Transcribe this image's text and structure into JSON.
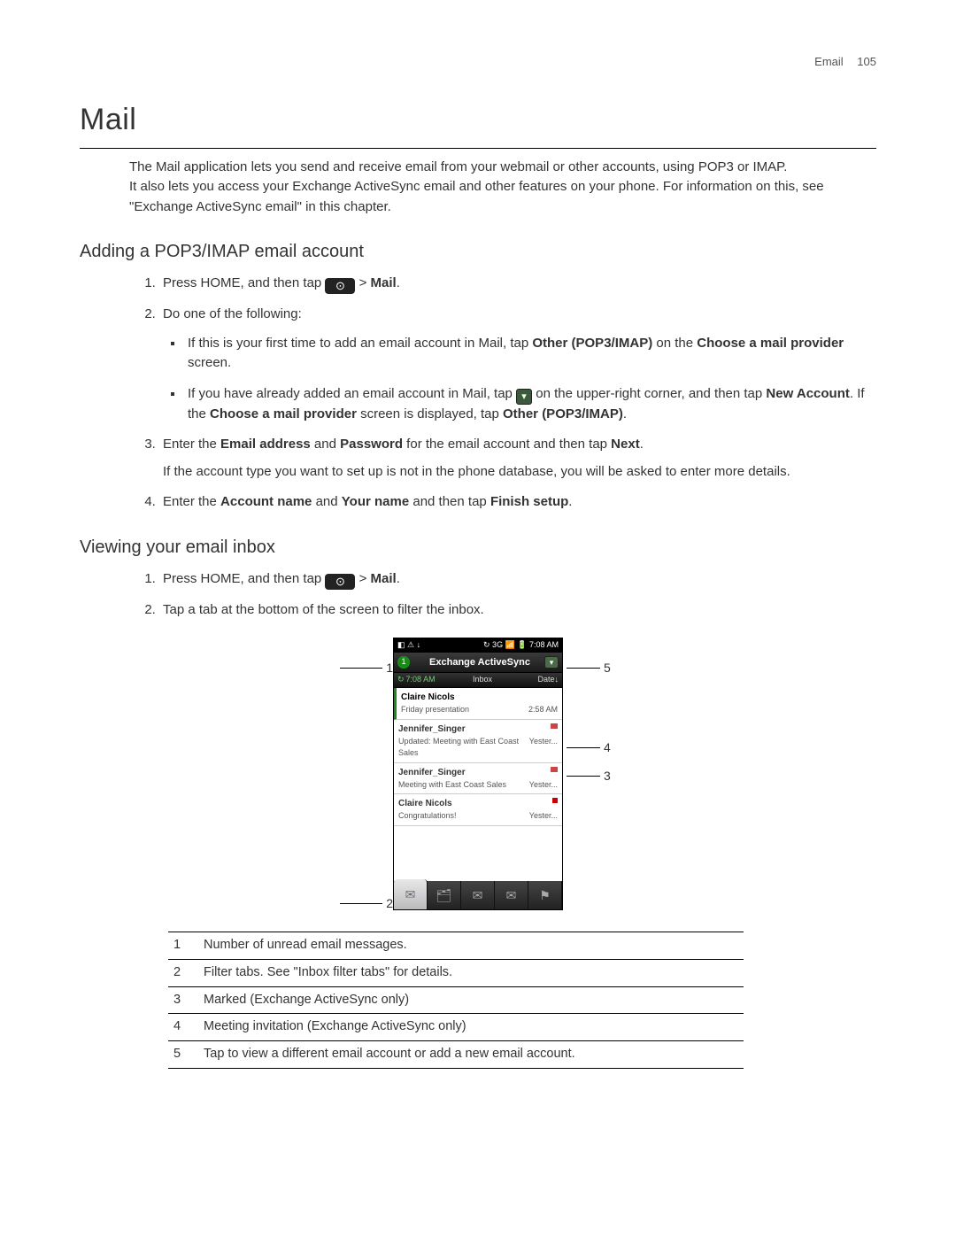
{
  "header": {
    "section": "Email",
    "page": "105"
  },
  "title": "Mail",
  "intro_p1": "The Mail application lets you send and receive email from your webmail or other accounts, using POP3 or IMAP.",
  "intro_p2a": "It also lets you access your Exchange ActiveSync email and other features on your phone. For information on this, see \"Exchange ActiveSync email\" in this chapter.",
  "h2_adding": "Adding a POP3/IMAP email account",
  "step1_pre": "Press HOME, and then tap ",
  "step1_mail_gt": "  > ",
  "step1_mail": "Mail",
  "step1_dot": ".",
  "step2": "Do one of the following:",
  "bullet1_a": "If this is your first time to add an email account in Mail, tap ",
  "bullet1_b": "Other (POP3/IMAP)",
  "bullet1_c": " on the ",
  "bullet1_d": "Choose a mail provider",
  "bullet1_e": " screen.",
  "bullet2_a": "If you have already added an email account in Mail, tap ",
  "bullet2_b": " on the upper-right corner, and then tap ",
  "bullet2_c": "New Account",
  "bullet2_d": ". If the ",
  "bullet2_e": "Choose a mail provider",
  "bullet2_f": " screen is displayed, tap ",
  "bullet2_g": "Other (POP3/IMAP)",
  "bullet2_h": ".",
  "step3_a": "Enter the ",
  "step3_b": "Email address",
  "step3_c": " and ",
  "step3_d": "Password",
  "step3_e": " for the email account and then tap ",
  "step3_f": "Next",
  "step3_g": ".",
  "step3_sub": "If the account type you want to set up is not in the phone database, you will be asked to enter more details.",
  "step4_a": "Enter the ",
  "step4_b": "Account name",
  "step4_c": " and ",
  "step4_d": "Your name",
  "step4_e": " and then tap ",
  "step4_f": "Finish setup",
  "step4_g": ".",
  "h2_viewing": "Viewing your email inbox",
  "view_step2": "Tap a tab at the bottom of the screen to filter the inbox.",
  "phone": {
    "status_left": "◧ ⚠ ↓",
    "status_right": "↻ 3G 📶 🔋 7:08 AM",
    "badge_count": "1",
    "account_title": "Exchange ActiveSync",
    "sync_time": "7:08 AM",
    "inbox_label": "Inbox",
    "date_label": "Date↓",
    "emails": [
      {
        "from": "Claire Nicols",
        "subj": "Friday presentation",
        "time": "2:58 AM",
        "unread": true
      },
      {
        "from": "Jennifer_Singer",
        "subj": "Updated: Meeting with East Coast Sales",
        "time": "Yester...",
        "flag": "meeting"
      },
      {
        "from": "Jennifer_Singer",
        "subj": "Meeting with East Coast Sales",
        "time": "Yester...",
        "flag": "meeting"
      },
      {
        "from": "Claire Nicols",
        "subj": "Congratulations!",
        "time": "Yester...",
        "flag": "mark"
      }
    ]
  },
  "callouts": {
    "c1": "1",
    "c2": "2",
    "c3": "3",
    "c4": "4",
    "c5": "5"
  },
  "legend": [
    {
      "n": "1",
      "t": "Number of unread email messages."
    },
    {
      "n": "2",
      "t": "Filter tabs. See \"Inbox filter tabs\" for details."
    },
    {
      "n": "3",
      "t": "Marked (Exchange ActiveSync only)"
    },
    {
      "n": "4",
      "t": "Meeting invitation (Exchange ActiveSync only)"
    },
    {
      "n": "5",
      "t": "Tap to view a different email account or add a new email account."
    }
  ]
}
